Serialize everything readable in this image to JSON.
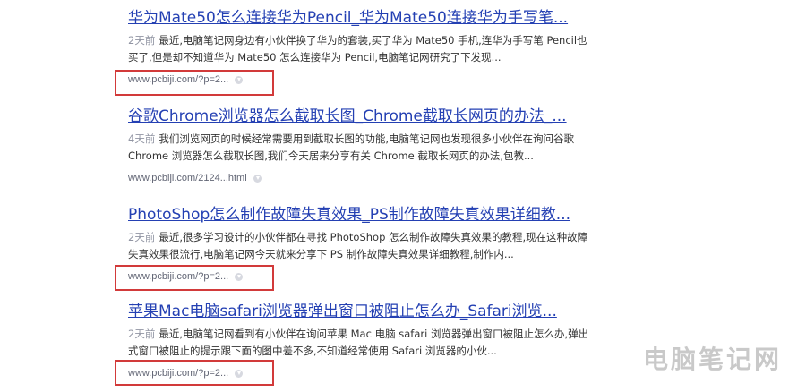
{
  "results": [
    {
      "title": "华为Mate50怎么连接华为Pencil_华为Mate50连接华为手写笔...",
      "time": "2天前",
      "abstract": "最近,电脑笔记网身边有小伙伴换了华为的套装,买了华为 Mate50 手机,连华为手写笔 Pencil也买了,但是却不知道华为 Mate50 怎么连接华为 Pencil,电脑笔记网研究了下发现...",
      "url": "www.pcbiji.com/?p=2..."
    },
    {
      "title": "谷歌Chrome浏览器怎么截取长图_Chrome截取长网页的办法_...",
      "time": "4天前",
      "abstract": "我们浏览网页的时候经常需要用到截取长图的功能,电脑笔记网也发现很多小伙伴在询问谷歌 Chrome 浏览器怎么截取长图,我们今天居来分享有关 Chrome 截取长网页的办法,包教...",
      "url": "www.pcbiji.com/2124...html"
    },
    {
      "title": "PhotoShop怎么制作故障失真效果_PS制作故障失真效果详细教...",
      "time": "2天前",
      "abstract": "最近,很多学习设计的小伙伴都在寻找 PhotoShop 怎么制作故障失真效果的教程,现在这种故障失真效果很流行,电脑笔记网今天就来分享下 PS 制作故障失真效果详细教程,制作内...",
      "url": "www.pcbiji.com/?p=2..."
    },
    {
      "title": "苹果Mac电脑safari浏览器弹出窗口被阻止怎么办_Safari浏览...",
      "time": "2天前",
      "abstract": "最近,电脑笔记网看到有小伙伴在询问苹果 Mac 电脑 safari 浏览器弹出窗口被阻止怎么办,弹出式窗口被阻止的提示跟下面的图中差不多,不知道经常使用 Safari 浏览器的小伙...",
      "url": "www.pcbiji.com/?p=2..."
    }
  ],
  "watermark": "电脑笔记网",
  "colors": {
    "link": "#2440b3",
    "highlight_box": "#d23a3a"
  },
  "icons": {
    "snapshot": "circle-chevron-down-icon"
  }
}
